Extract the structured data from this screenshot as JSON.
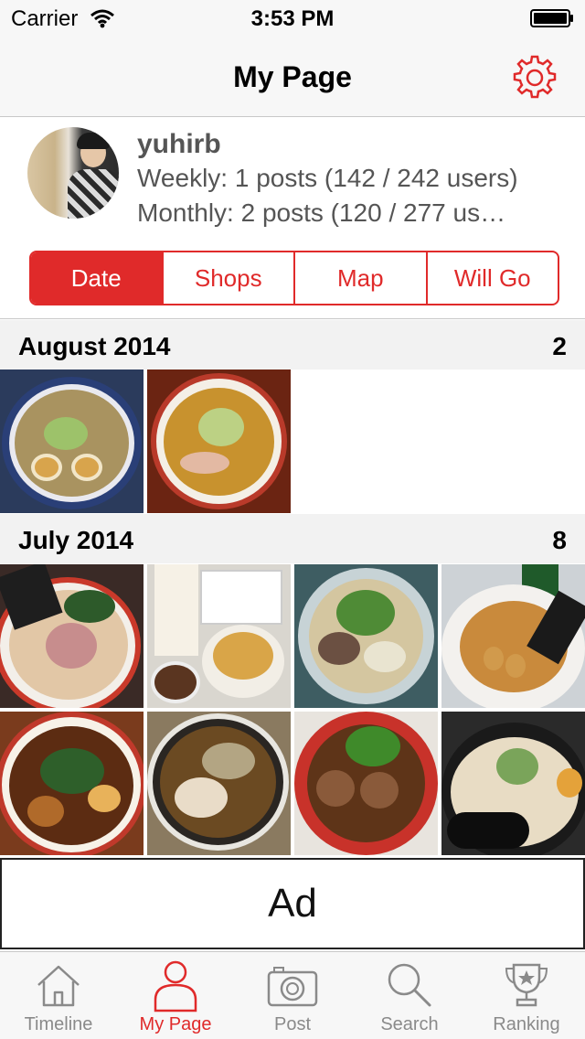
{
  "status": {
    "carrier": "Carrier",
    "time": "3:53 PM"
  },
  "nav": {
    "title": "My Page"
  },
  "profile": {
    "username": "yuhirb",
    "weekly": "Weekly: 1 posts (142 / 242 users)",
    "monthly": "Monthly: 2 posts (120 / 277 us…"
  },
  "segments": [
    "Date",
    "Shops",
    "Map",
    "Will Go"
  ],
  "sections": [
    {
      "label": "August 2014",
      "count": "2"
    },
    {
      "label": "July 2014",
      "count": "8"
    }
  ],
  "ad": {
    "label": "Ad"
  },
  "tabs": [
    "Timeline",
    "My Page",
    "Post",
    "Search",
    "Ranking"
  ],
  "colors": {
    "accent": "#e02a2a"
  },
  "icons": {
    "tab_icons": [
      "house-icon",
      "person-icon",
      "camera-icon",
      "magnifier-icon",
      "trophy-icon"
    ],
    "nav_icon": "gear-icon"
  }
}
